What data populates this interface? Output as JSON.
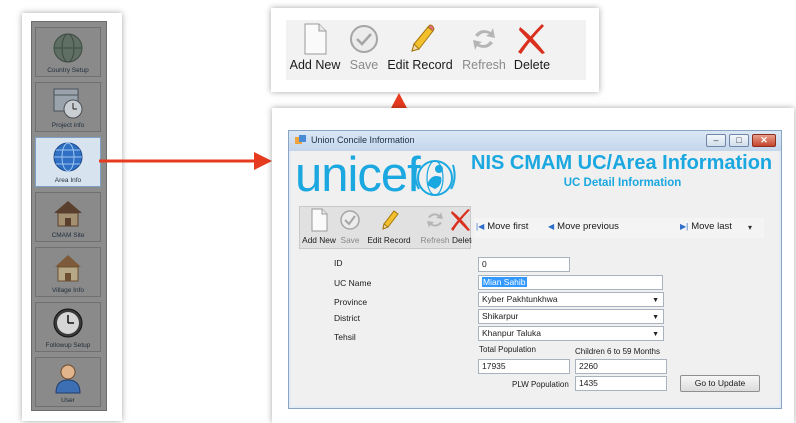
{
  "sidebar": {
    "items": [
      {
        "label": "Country Setup",
        "icon": "globe-icon",
        "selected": false
      },
      {
        "label": "Project info",
        "icon": "calendar-clock-icon",
        "selected": false
      },
      {
        "label": "Area Info",
        "icon": "globe-icon",
        "selected": true
      },
      {
        "label": "CMAM Site",
        "icon": "house-icon",
        "selected": false
      },
      {
        "label": "Village Info",
        "icon": "house-icon",
        "selected": false
      },
      {
        "label": "Followup Setup",
        "icon": "clock-icon",
        "selected": false
      },
      {
        "label": "User",
        "icon": "user-icon",
        "selected": false
      }
    ]
  },
  "toolbar": {
    "add_new": "Add New",
    "save": "Save",
    "edit_record": "Edit Record",
    "refresh": "Refresh",
    "delete": "Delete"
  },
  "window": {
    "title": "Union Concile Information",
    "buttons": {
      "minimize": "–",
      "maximize": "□",
      "close": "✕"
    }
  },
  "header": {
    "logo_text": "unicef",
    "title": "NIS CMAM UC/Area Information",
    "subtitle": "UC Detail Information"
  },
  "inner_toolbar": {
    "add_new": "Add New",
    "save": "Save",
    "edit_record": "Edit Record",
    "refresh": "Refresh",
    "delete": "Delete"
  },
  "navigator": {
    "move_first": "Move first",
    "move_previous": "Move previous",
    "move_last": "Move last",
    "more": "▾"
  },
  "form": {
    "id_label": "ID",
    "id_value": "0",
    "uc_name_label": "UC Name",
    "uc_name_value": "Mian Sahib",
    "province_label": "Province",
    "province_value": "Kyber Pakhtunkhwa",
    "district_label": "District",
    "district_value": "Shikarpur",
    "tehsil_label": "Tehsil",
    "tehsil_value": "Khanpur Taluka",
    "total_population_label": "Total Population",
    "total_population_value": "17935",
    "children_label": "Children 6 to 59 Months",
    "children_value": "2260",
    "plw_label": "PLW Population",
    "plw_value": "1435",
    "go_to_update": "Go to Update"
  },
  "colors": {
    "unicef_blue": "#1ba7e0",
    "arrow_red": "#e63b1e",
    "delete_red": "#d9301f"
  }
}
